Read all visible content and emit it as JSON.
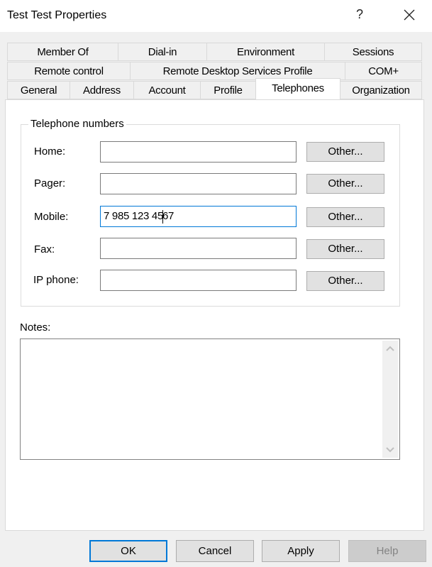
{
  "window": {
    "title": "Test Test Properties",
    "help_label": "?",
    "close_icon": "close-icon"
  },
  "tabs": {
    "row1": [
      "Member Of",
      "Dial-in",
      "Environment",
      "Sessions"
    ],
    "row2": [
      "Remote control",
      "Remote Desktop Services Profile",
      "COM+"
    ],
    "row3": [
      "General",
      "Address",
      "Account",
      "Profile",
      "Telephones",
      "Organization"
    ],
    "selected": "Telephones"
  },
  "telephones": {
    "group_title": "Telephone numbers",
    "fields": [
      {
        "label": "Home:",
        "value": "",
        "button": "Other..."
      },
      {
        "label": "Pager:",
        "value": "",
        "button": "Other..."
      },
      {
        "label": "Mobile:",
        "value_before_caret": "7 985 123 45",
        "value_after_caret": "67",
        "button": "Other..."
      },
      {
        "label": "Fax:",
        "value": "",
        "button": "Other..."
      },
      {
        "label": "IP phone:",
        "value": "",
        "button": "Other..."
      }
    ]
  },
  "notes": {
    "label": "Notes:",
    "value": ""
  },
  "buttons": {
    "ok": "OK",
    "cancel": "Cancel",
    "apply": "Apply",
    "help": "Help"
  },
  "colors": {
    "accent": "#0078d7",
    "dialog_bg": "#f0f0f0",
    "button_bg": "#e1e1e1",
    "disabled_text": "#838383"
  }
}
